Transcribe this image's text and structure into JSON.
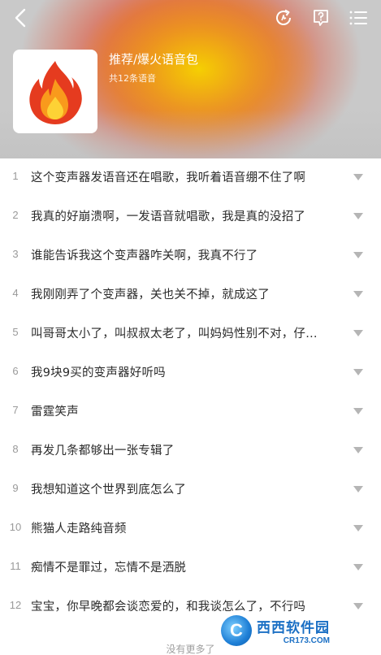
{
  "header": {
    "icons": {
      "back": "back-arrow-icon",
      "refresh": "refresh-icon",
      "help": "help-icon",
      "list": "list-icon"
    },
    "cover_icon": "fire-icon",
    "title": "推荐/爆火语音包",
    "count": "共12条语音",
    "colors": {
      "glow_red": "#e84024",
      "glow_yellow": "#f6d600",
      "base": "#c9c9c9"
    }
  },
  "items": [
    {
      "index": "1",
      "text": "这个变声器发语音还在唱歌，我听着语音绷不住了啊"
    },
    {
      "index": "2",
      "text": "我真的好崩溃啊，一发语音就唱歌，我是真的没招了"
    },
    {
      "index": "3",
      "text": "谁能告诉我这个变声器咋关啊，我真不行了"
    },
    {
      "index": "4",
      "text": "我刚刚弄了个变声器，关也关不掉，就成这了"
    },
    {
      "index": "5",
      "text": "叫哥哥太小了，叫叔叔太老了，叫妈妈性别不对，仔…"
    },
    {
      "index": "6",
      "text": "我9块9买的变声器好听吗"
    },
    {
      "index": "7",
      "text": "雷霆笑声"
    },
    {
      "index": "8",
      "text": "再发几条都够出一张专辑了"
    },
    {
      "index": "9",
      "text": "我想知道这个世界到底怎么了"
    },
    {
      "index": "10",
      "text": "熊猫人走路纯音频"
    },
    {
      "index": "11",
      "text": "痴情不是罪过，忘情不是洒脱"
    },
    {
      "index": "12",
      "text": "宝宝，你早晚都会谈恋爱的，和我谈怎么了，不行吗"
    }
  ],
  "footer": {
    "text": "没有更多了"
  },
  "watermark": {
    "logo_letter": "C",
    "main": "西西软件园",
    "sub": "CR173.COM"
  }
}
